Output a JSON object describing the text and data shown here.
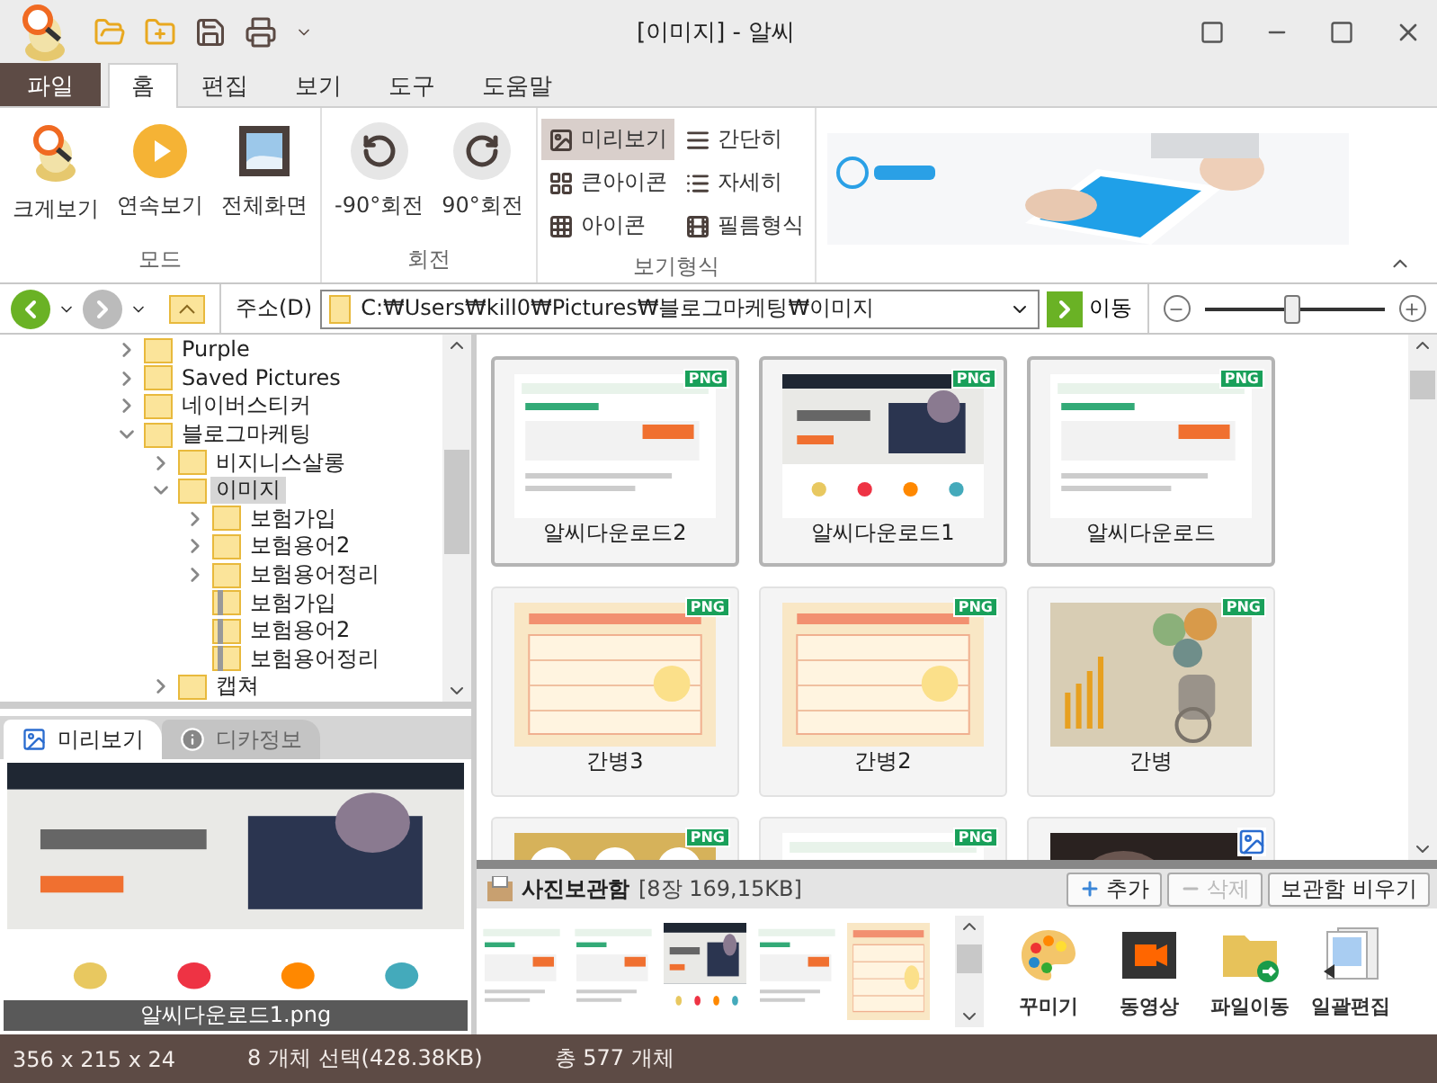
{
  "window": {
    "title": "[이미지] - 알씨"
  },
  "ribbon_tabs": [
    {
      "label": "파일",
      "kind": "file",
      "selected": false
    },
    {
      "label": "홈",
      "kind": "tab",
      "selected": true
    },
    {
      "label": "편집",
      "kind": "tab",
      "selected": false
    },
    {
      "label": "보기",
      "kind": "tab",
      "selected": false
    },
    {
      "label": "도구",
      "kind": "tab",
      "selected": false
    },
    {
      "label": "도움말",
      "kind": "tab",
      "selected": false
    }
  ],
  "ribbon_groups": [
    {
      "label": "모드",
      "buttons": [
        "크게보기",
        "연속보기",
        "전체화면"
      ]
    },
    {
      "label": "회전",
      "buttons": [
        "-90°회전",
        "90°회전"
      ]
    }
  ],
  "view_modes": {
    "label": "보기형식",
    "items": [
      {
        "label": "미리보기",
        "selected": true
      },
      {
        "label": "큰아이콘",
        "selected": false
      },
      {
        "label": "아이콘",
        "selected": false
      },
      {
        "label": "간단히",
        "selected": false
      },
      {
        "label": "자세히",
        "selected": false
      },
      {
        "label": "필름형식",
        "selected": false
      }
    ]
  },
  "address_bar": {
    "label": "주소(D)",
    "path": "C:₩Users₩kill0₩Pictures₩블로그마케팅₩이미지",
    "go_label": "이동",
    "zoom": {
      "level": 0.48
    }
  },
  "folder_tree": [
    {
      "label": "Purple",
      "kind": "folder",
      "expanded": false,
      "selected": false
    },
    {
      "label": "Saved Pictures",
      "kind": "folder",
      "expanded": false,
      "selected": false
    },
    {
      "label": "네이버스티커",
      "kind": "folder",
      "expanded": false,
      "selected": false
    },
    {
      "label": "블로그마케팅",
      "kind": "folder",
      "expanded": true,
      "selected": false,
      "children": [
        {
          "label": "비지니스살롱",
          "kind": "folder",
          "expanded": false,
          "selected": false
        },
        {
          "label": "이미지",
          "kind": "folder",
          "expanded": true,
          "selected": true,
          "children": [
            {
              "label": "보험가입",
              "kind": "folder",
              "expanded": false,
              "selected": false
            },
            {
              "label": "보험용어2",
              "kind": "folder",
              "expanded": false,
              "selected": false
            },
            {
              "label": "보험용어정리",
              "kind": "folder",
              "expanded": false,
              "selected": false
            },
            {
              "label": "보험가입",
              "kind": "zip",
              "selected": false
            },
            {
              "label": "보험용어2",
              "kind": "zip",
              "selected": false
            },
            {
              "label": "보험용어정리",
              "kind": "zip",
              "selected": false
            }
          ]
        },
        {
          "label": "캡쳐",
          "kind": "folder",
          "expanded": false,
          "selected": false
        }
      ]
    }
  ],
  "preview_tabs": [
    {
      "label": "미리보기",
      "selected": true
    },
    {
      "label": "디카정보",
      "selected": false
    }
  ],
  "preview": {
    "caption": "알씨다운로드1.png"
  },
  "thumbnails": [
    {
      "label": "알씨다운로드2",
      "badge": "PNG",
      "selected": true
    },
    {
      "label": "알씨다운로드1",
      "badge": "PNG",
      "selected": true
    },
    {
      "label": "알씨다운로드",
      "badge": "PNG",
      "selected": true
    },
    {
      "label": "간병3",
      "badge": "PNG",
      "selected": false
    },
    {
      "label": "간병2",
      "badge": "PNG",
      "selected": false
    },
    {
      "label": "간병",
      "badge": "PNG",
      "selected": false
    },
    {
      "badge": "PNG",
      "selected": false
    },
    {
      "badge": "PNG",
      "selected": false
    },
    {
      "selected": false
    }
  ],
  "photo_box": {
    "title": "사진보관함",
    "count": "[8장 169,15KB]",
    "buttons": [
      {
        "label": "추가",
        "disabled": false
      },
      {
        "label": "삭제",
        "disabled": true
      },
      {
        "label": "보관함 비우기",
        "disabled": false
      }
    ],
    "tools": [
      "꾸미기",
      "동영상",
      "파일이동",
      "일괄편집"
    ]
  },
  "status_bar": [
    "356 x 215 x 24",
    "8 개체 선택(428.38KB)",
    "총 577 개체"
  ]
}
